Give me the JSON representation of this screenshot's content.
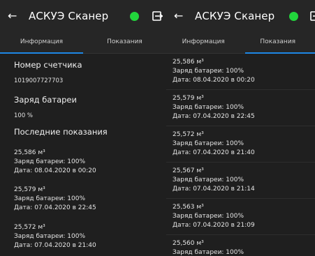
{
  "app": {
    "title": "АСКУЭ Сканер",
    "status_color": "#22d63c"
  },
  "tabs": [
    "Информация",
    "Показания"
  ],
  "info": {
    "meter_label": "Номер счетчика",
    "meter_value": "1019007727703",
    "battery_label": "Заряд батареи",
    "battery_value": "100 %",
    "last_label": "Последние показания"
  },
  "readings": [
    {
      "value": "25,586 м³",
      "battery": "Заряд батареи: 100%",
      "date": "Дата: 08.04.2020 в 00:20"
    },
    {
      "value": "25,579 м³",
      "battery": "Заряд батареи: 100%",
      "date": "Дата: 07.04.2020 в 22:45"
    },
    {
      "value": "25,572 м³",
      "battery": "Заряд батареи: 100%",
      "date": "Дата: 07.04.2020 в 21:40"
    },
    {
      "value": "25,567 м³",
      "battery": "Заряд батареи: 100%",
      "date": "Дата: 07.04.2020 в 21:14"
    },
    {
      "value": "25,563 м³",
      "battery": "Заряд батареи: 100%",
      "date": "Дата: 07.04.2020 в 21:09"
    },
    {
      "value": "25,560 м³",
      "battery": "Заряд батареи: 100%",
      "date": ""
    }
  ]
}
